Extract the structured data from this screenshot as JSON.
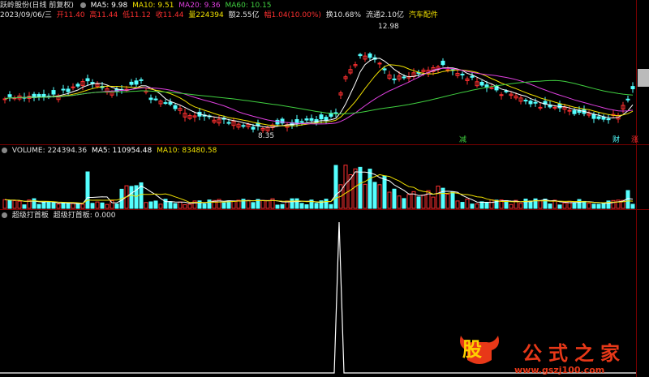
{
  "header": {
    "stock_name": "跃岭股份(日线 前复权)",
    "ma": [
      {
        "label": "MA5: 9.98",
        "color": "#ffffff"
      },
      {
        "label": "MA10: 9.51",
        "color": "#f0e000"
      },
      {
        "label": "MA20: 9.36",
        "color": "#e040e0"
      },
      {
        "label": "MA60: 10.15",
        "color": "#40d040"
      }
    ]
  },
  "info": {
    "date": "2023/09/06/三",
    "open": "开11.40",
    "high": "高11.44",
    "low": "低11.12",
    "close": "收11.44",
    "volume": "量224394",
    "amount": "额2.55亿",
    "change": "幅1.04(10.00%)",
    "turnover": "换10.68%",
    "float": "流通2.10亿",
    "industry": "汽车配件"
  },
  "price_chart": {
    "high_label": "12.98",
    "low_label": "8.35",
    "left_label": "减",
    "tag_cai": "财",
    "tag_zhang": "涨"
  },
  "volume_panel": {
    "title": "VOLUME: 224394.36",
    "ma5": "MA5: 110954.48",
    "ma10": "MA10: 83480.58"
  },
  "indicator_panel": {
    "title": "超级打首板",
    "series": "超级打首板: 0.000"
  },
  "watermark": {
    "logo_char": "股",
    "brand": "公式之家",
    "url": "www.gszj100.com"
  },
  "colors": {
    "up": "#ff3030",
    "down": "#54ffff",
    "ma5": "#ffffff",
    "ma10": "#f0e000",
    "ma20": "#e040e0",
    "ma60": "#40d040"
  }
}
